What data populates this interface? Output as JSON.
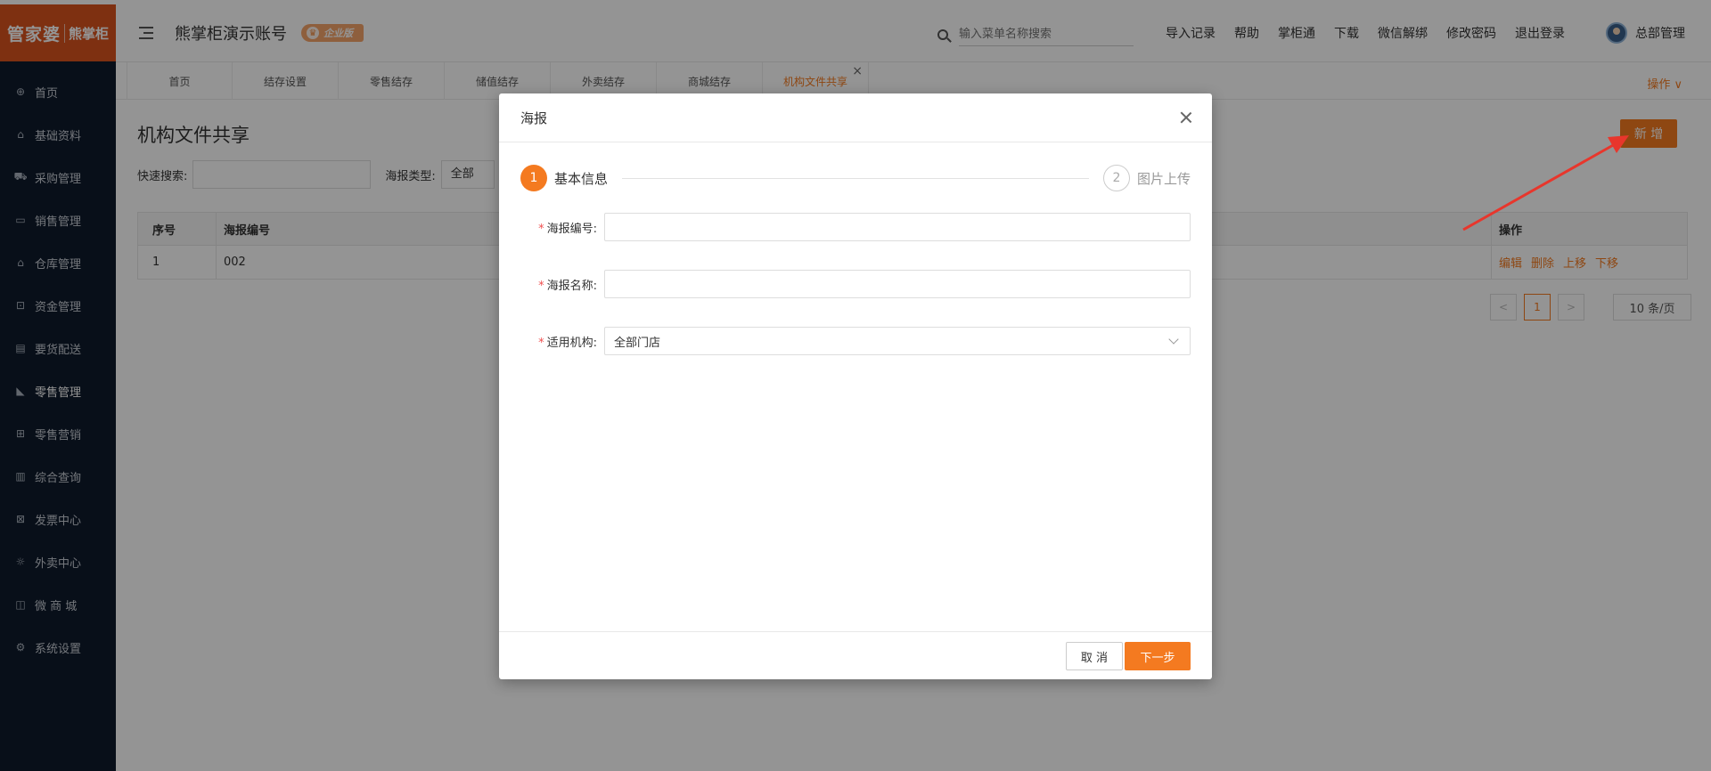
{
  "app": {
    "logo_main": "管家婆",
    "logo_sub": "熊掌柜",
    "account_name": "熊掌柜演示账号",
    "edition_badge": "企业版"
  },
  "sidebar": {
    "items": [
      {
        "label": "首页",
        "icon": "globe-icon"
      },
      {
        "label": "基础资料",
        "icon": "home-icon"
      },
      {
        "label": "采购管理",
        "icon": "cart-icon"
      },
      {
        "label": "销售管理",
        "icon": "sales-icon"
      },
      {
        "label": "仓库管理",
        "icon": "warehouse-icon"
      },
      {
        "label": "资金管理",
        "icon": "money-icon"
      },
      {
        "label": "要货配送",
        "icon": "delivery-icon"
      },
      {
        "label": "零售管理",
        "icon": "retail-chart-icon"
      },
      {
        "label": "零售营销",
        "icon": "gift-icon"
      },
      {
        "label": "综合查询",
        "icon": "bar-chart-icon"
      },
      {
        "label": "发票中心",
        "icon": "invoice-icon"
      },
      {
        "label": "外卖中心",
        "icon": "takeout-icon"
      },
      {
        "label": "微 商 城",
        "icon": "bag-icon"
      },
      {
        "label": "系统设置",
        "icon": "gear-icon"
      }
    ]
  },
  "header": {
    "search_placeholder": "输入菜单名称搜索",
    "links": [
      "导入记录",
      "帮助",
      "掌柜通",
      "下载",
      "微信解绑",
      "修改密码",
      "退出登录"
    ],
    "user_name": "总部管理"
  },
  "tabs": {
    "items": [
      "首页",
      "结存设置",
      "零售结存",
      "储值结存",
      "外卖结存",
      "商城结存",
      "机构文件共享"
    ],
    "active_index": 6,
    "ops_label": "操作 ∨"
  },
  "main": {
    "title": "机构文件共享",
    "add_button": "新 增",
    "quick_search_label": "快速搜索:",
    "poster_type_label": "海报类型:",
    "poster_type_value": "全部",
    "table": {
      "headers": [
        "序号",
        "海报编号",
        "操作"
      ],
      "rows": [
        {
          "index": "1",
          "code": "002",
          "actions": [
            "编辑",
            "删除",
            "上移",
            "下移"
          ]
        }
      ]
    },
    "pager": {
      "prev": "<",
      "current": "1",
      "next": ">",
      "page_size": "10 条/页"
    }
  },
  "modal": {
    "title": "海报",
    "steps": [
      {
        "num": "1",
        "label": "基本信息",
        "active": true
      },
      {
        "num": "2",
        "label": "图片上传",
        "active": false
      }
    ],
    "fields": {
      "code_label": "海报编号:",
      "name_label": "海报名称:",
      "org_label": "适用机构:",
      "org_value": "全部门店",
      "required_mark": "*"
    },
    "cancel_label": "取 消",
    "next_label": "下一步"
  },
  "colors": {
    "accent": "#f47a20",
    "sidebar_bg": "#0e1a2b",
    "logo_bg": "#d9531e",
    "annotation_arrow": "#e8362c"
  }
}
